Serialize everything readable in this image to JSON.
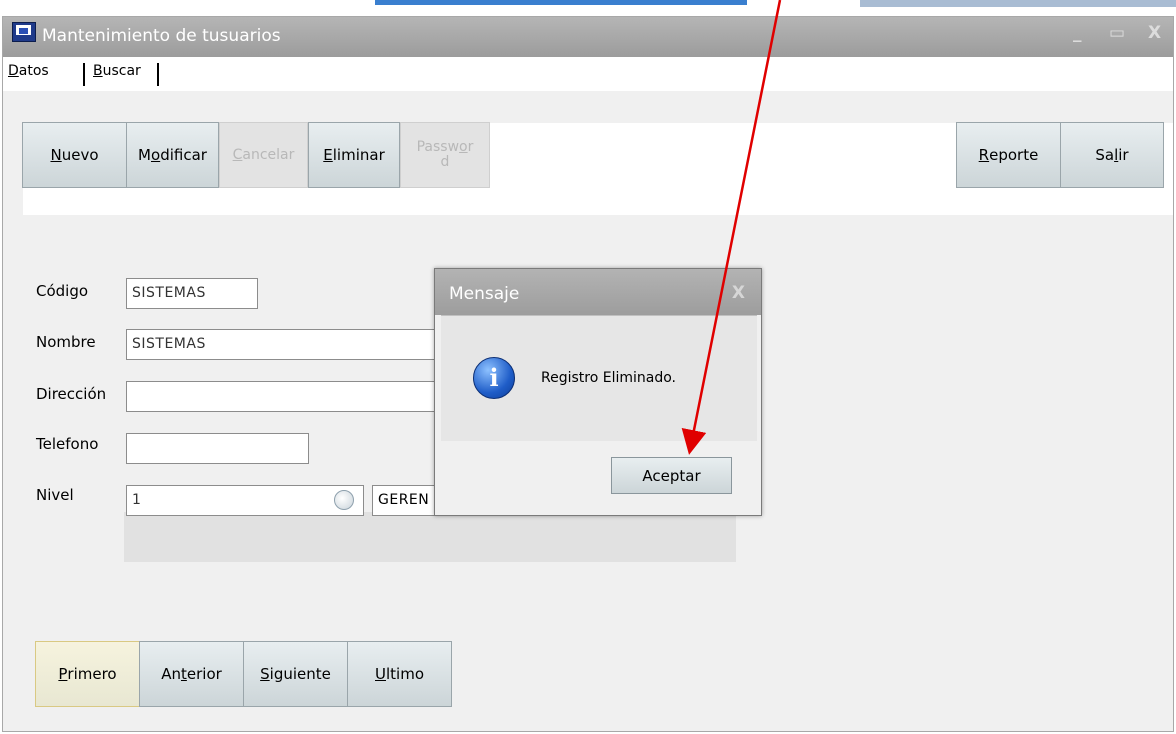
{
  "window": {
    "title": "Mantenimiento de tusuarios"
  },
  "tabs": [
    {
      "key": "D",
      "rest": "atos"
    },
    {
      "key": "B",
      "rest": "uscar"
    }
  ],
  "toolbar": {
    "nuevo": {
      "before": "",
      "key": "N",
      "after": "uevo"
    },
    "modificar": {
      "before": "M",
      "key": "o",
      "after": "dificar"
    },
    "cancelar": {
      "before": "",
      "key": "C",
      "after": "ancelar"
    },
    "eliminar": {
      "before": "",
      "key": "E",
      "after": "liminar"
    },
    "password": {
      "line1_before": "Passw",
      "line1_key": "o",
      "line1_after": "r",
      "line2": "d"
    },
    "reporte": {
      "before": "",
      "key": "R",
      "after": "eporte"
    },
    "salir": {
      "before": "Sa",
      "key": "l",
      "after": "ir"
    }
  },
  "form": {
    "codigo_label": "Código",
    "codigo_value": "SISTEMAS",
    "nombre_label": "Nombre",
    "nombre_value": "SISTEMAS",
    "direccion_label": "Dirección",
    "direccion_value": "",
    "telefono_label": "Telefono",
    "telefono_value": "",
    "nivel_label": "Nivel",
    "nivel_value": "1",
    "nivel_desc": "GEREN"
  },
  "nav": {
    "primero": {
      "before": "",
      "key": "P",
      "after": "rimero"
    },
    "anterior": {
      "before": "An",
      "key": "t",
      "after": "erior"
    },
    "siguiente": {
      "before": "",
      "key": "S",
      "after": "iguiente"
    },
    "ultimo": {
      "before": "",
      "key": "U",
      "after": "ltimo"
    }
  },
  "dialog": {
    "title": "Mensaje",
    "close": "X",
    "message": "Registro Eliminado.",
    "button": "Aceptar",
    "icon": "info-icon"
  },
  "window_controls": {
    "minimize": "_",
    "maximize": "▭",
    "close": "X"
  },
  "colors": {
    "titlebar": "#a7a7a7",
    "annotation_arrow": "#e00000",
    "info_icon": "#1f5dc8"
  }
}
